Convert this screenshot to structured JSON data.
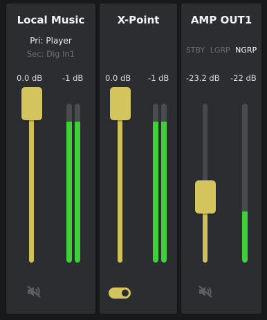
{
  "channels": [
    {
      "title": "Local Music",
      "primary": "Pri: Player",
      "secondary": "Sec: Dig In1",
      "gain_label": "0.0 dB",
      "level_label": "-1 dB",
      "gain_position": 1.0,
      "meter_levels": [
        0.9,
        0.9
      ],
      "control": "mute-icon"
    },
    {
      "title": "X-Point",
      "gain_label": "0.0 dB",
      "level_label": "-1 dB",
      "gain_position": 1.0,
      "meter_levels": [
        0.9,
        0.9
      ],
      "control": "toggle-switch",
      "toggle_on": true
    },
    {
      "title": "AMP OUT1",
      "modes": [
        "STBY",
        "LGRP",
        "NGRP"
      ],
      "active_mode": "NGRP",
      "gain_label": "-23.2 dB",
      "level_label": "-22 dB",
      "gain_position": 0.4,
      "meter_levels": [
        0.3
      ],
      "control": "mute-icon"
    }
  ],
  "colors": {
    "background": "#18191b",
    "panel": "#2c2d31",
    "fader": "#d4c45d",
    "meter_fill": "#3ecf3a",
    "meter_empty": "#4a4b4f",
    "muted_text": "#6f7074"
  }
}
